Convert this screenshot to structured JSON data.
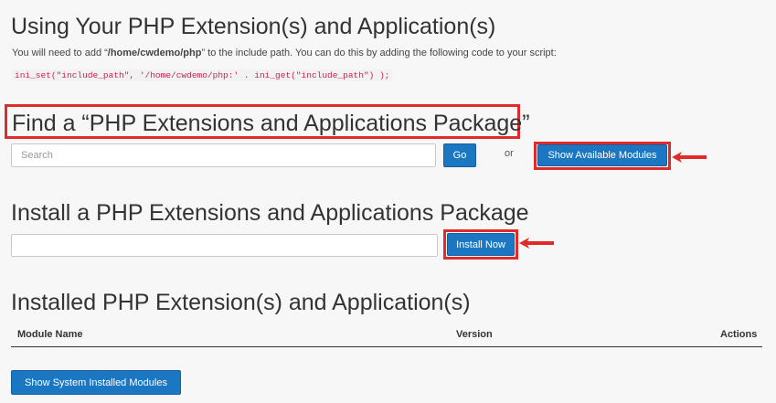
{
  "using_section": {
    "title": "Using Your PHP Extension(s) and Application(s)",
    "intro_prefix": "You will need to add “",
    "intro_path": "/home/cwdemo/php",
    "intro_suffix": "” to the include path. You can do this by adding the following code to your script:",
    "code": "ini_set(\"include_path\", '/home/cwdemo/php:' . ini_get(\"include_path\") );"
  },
  "find_section": {
    "title": "Find a “PHP Extensions and Applications Package”",
    "search_placeholder": "Search",
    "search_value": "",
    "go_label": "Go",
    "or_text": "or",
    "show_available_label": "Show Available Modules"
  },
  "install_section": {
    "title": "Install a PHP Extensions and Applications Package",
    "input_value": "",
    "install_label": "Install Now"
  },
  "installed_section": {
    "title": "Installed PHP Extension(s) and Application(s)",
    "columns": [
      "Module Name",
      "Version",
      "Actions"
    ],
    "show_system_label": "Show System Installed Modules"
  },
  "colors": {
    "highlight": "#e02b2b",
    "button": "#1c77c3",
    "code_text": "#c7254e"
  }
}
